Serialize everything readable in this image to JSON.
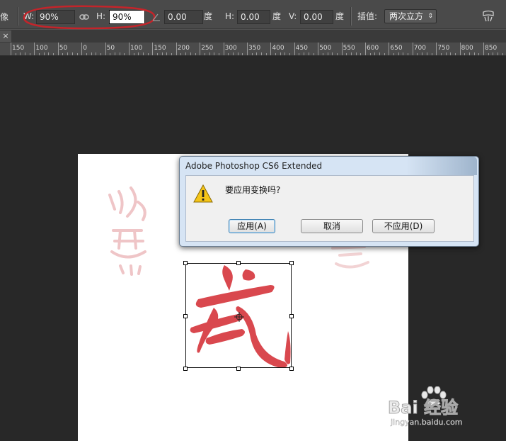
{
  "options_bar": {
    "ref_label": "像",
    "w_label": "W:",
    "w_value": "90%",
    "link_icon": "chain-link-icon",
    "h_label": "H:",
    "h_value": "90%",
    "rotate_icon": "angle-icon",
    "angle_value": "0.00",
    "angle_unit": "度",
    "skew_h_label": "H:",
    "skew_h_value": "0.00",
    "skew_h_unit": "度",
    "skew_v_label": "V:",
    "skew_v_value": "0.00",
    "skew_v_unit": "度",
    "interp_label": "插值:",
    "interp_value": "两次立方",
    "warp_icon": "warp-icon"
  },
  "tab": {
    "close_glyph": "×"
  },
  "ruler": {
    "labels": [
      "150",
      "100",
      "50",
      "0",
      "50",
      "100",
      "150",
      "200",
      "250",
      "300",
      "350",
      "400",
      "450",
      "500",
      "550",
      "600",
      "650",
      "700",
      "750",
      "800",
      "850"
    ]
  },
  "dialog": {
    "title": "Adobe Photoshop CS6 Extended",
    "message": "要应用变换吗?",
    "apply_label": "应用(A)",
    "cancel_label": "取消",
    "dont_apply_label": "不应用(D)",
    "warning_icon": "warning-icon"
  },
  "watermark": {
    "brand": "Bai 经验",
    "url": "jingyan.baidu.com"
  },
  "colors": {
    "ink_red": "#d9484e",
    "accent_blue": "#3c7fb1",
    "annotation_red": "#c4242a"
  }
}
